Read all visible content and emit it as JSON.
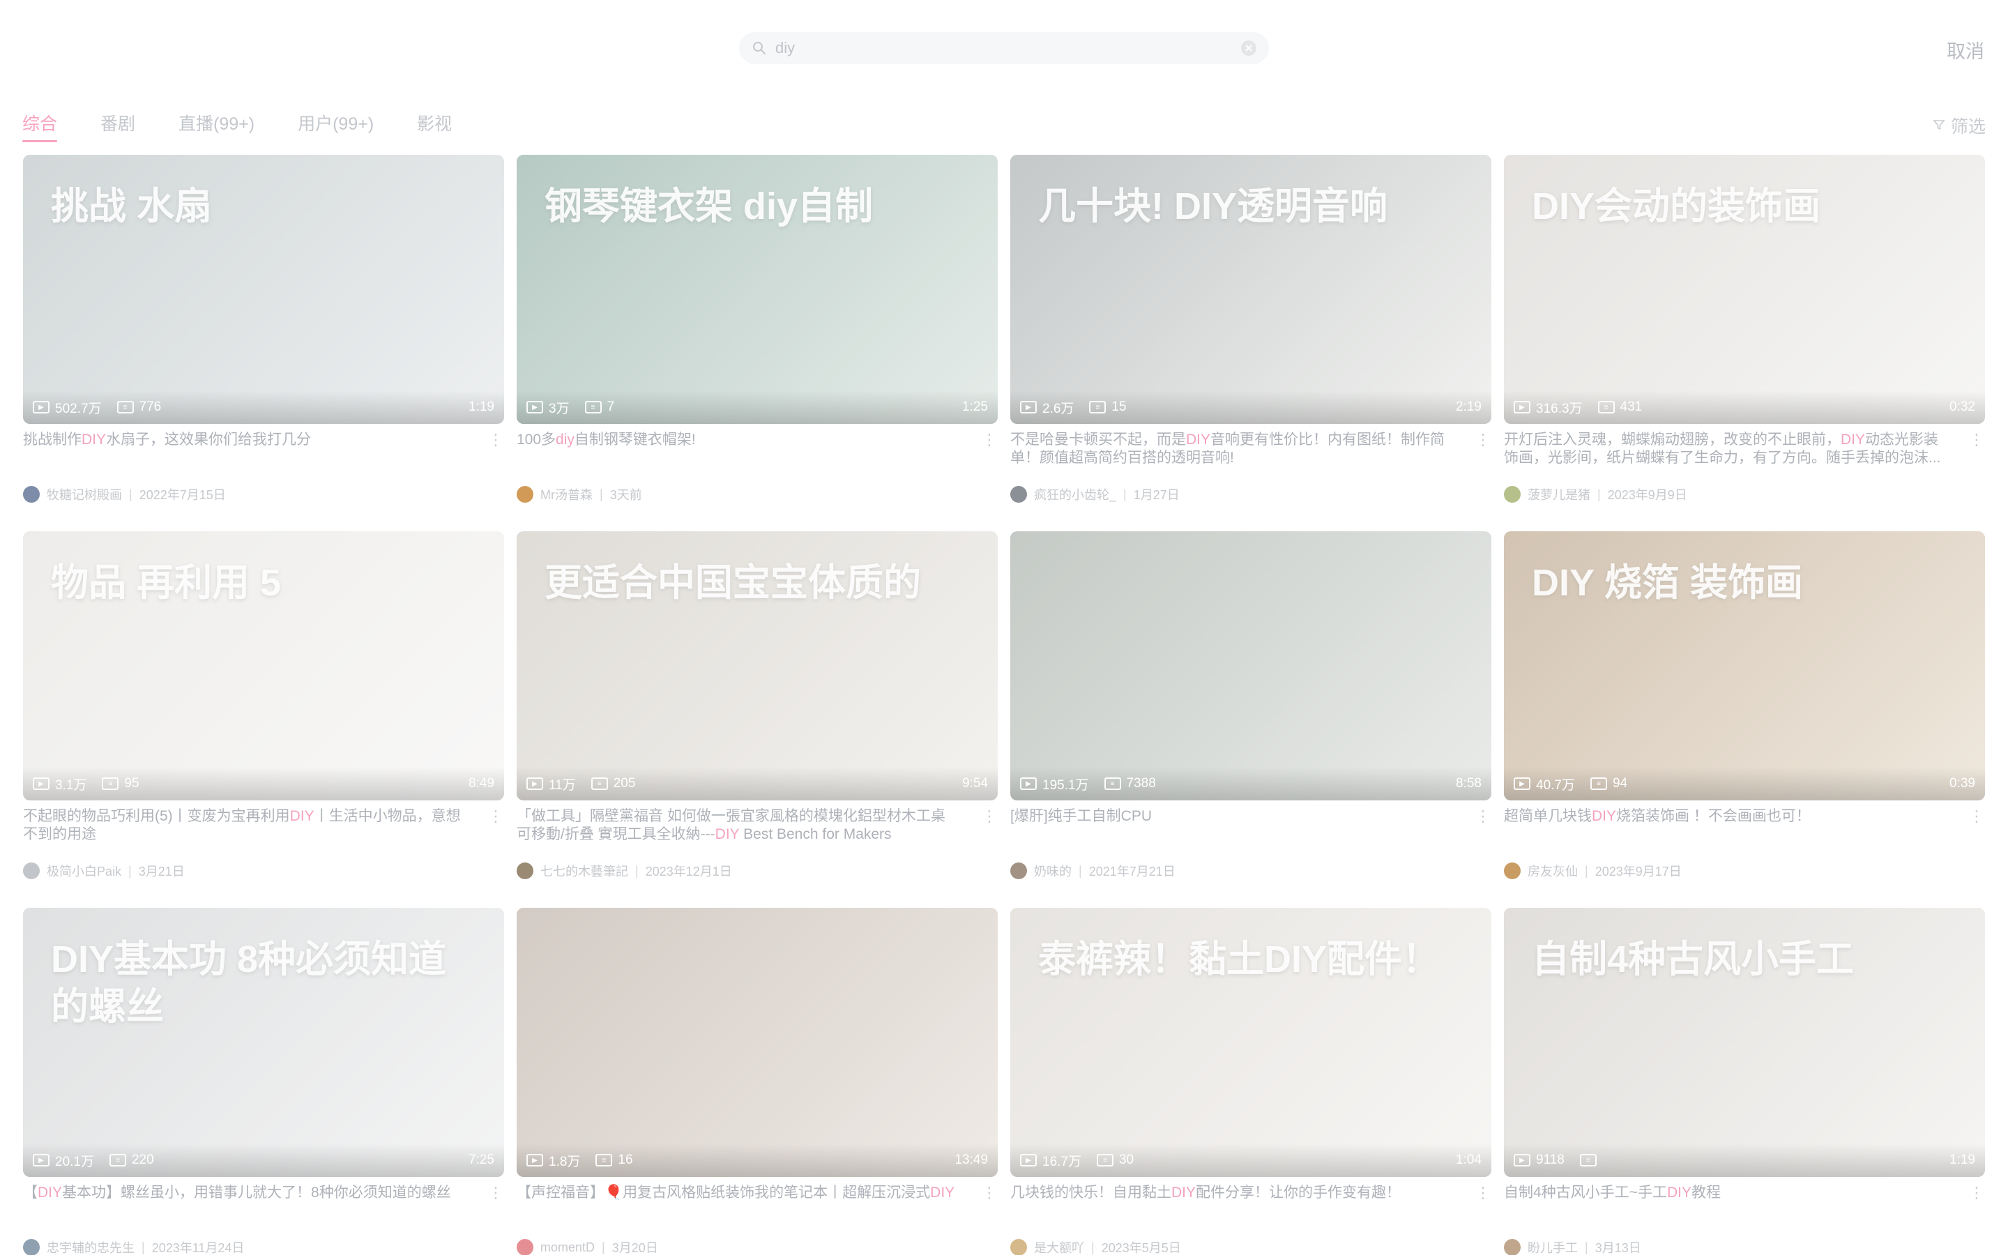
{
  "search": {
    "value": "diy",
    "cancel_label": "取消"
  },
  "tabs": [
    {
      "label": "综合",
      "active": true
    },
    {
      "label": "番剧",
      "active": false
    },
    {
      "label": "直播(99+)",
      "active": false
    },
    {
      "label": "用户(99+)",
      "active": false
    },
    {
      "label": "影视",
      "active": false
    }
  ],
  "filter_label": "筛选",
  "colors": {
    "accent": "#f6a3bf",
    "highlight": "#f4a3bd"
  },
  "videos": [
    {
      "title": "挑战制作DIY水扇子，这效果你们给我打几分",
      "views": "502.7万",
      "danmaku": "776",
      "duration": "1:19",
      "author": "牧糖记树殿画",
      "date": "2022年7月15日",
      "thumb_text": "挑战 水扇",
      "thumb_colors": [
        "#9aa7a9",
        "#d8dde0"
      ],
      "avatar_color": "#7d8ca8"
    },
    {
      "title": "100多diy自制钢琴键衣帽架!",
      "views": "3万",
      "danmaku": "7",
      "duration": "1:25",
      "author": "Mr汤普森",
      "date": "3天前",
      "thumb_text": "钢琴键衣架 diy自制",
      "thumb_colors": [
        "#5f8a7c",
        "#c7d6cf"
      ],
      "avatar_color": "#d19a56"
    },
    {
      "title": "不是哈曼卡顿买不起，而是DIY音响更有性价比！内有图纸！制作简单！颜值超高简约百搭的透明音响!",
      "views": "2.6万",
      "danmaku": "15",
      "duration": "2:19",
      "author": "疯狂的小齿轮_",
      "date": "1月27日",
      "thumb_text": "几十块! DIY透明音响",
      "thumb_colors": [
        "#7d8688",
        "#e1e2dd"
      ],
      "avatar_color": "#8b8f96"
    },
    {
      "title": "开灯后注入灵魂，蝴蝶煽动翅膀，改变的不止眼前，DIY动态光影装饰画，光影间，纸片蝴蝶有了生命力，有了方向。随手丢掉的泡沫...",
      "views": "316.3万",
      "danmaku": "431",
      "duration": "0:32",
      "author": "菠萝儿是猪",
      "date": "2023年9月9日",
      "thumb_text": "DIY会动的装饰画",
      "thumb_colors": [
        "#c6c1bb",
        "#ecebe8"
      ],
      "avatar_color": "#b5c08a"
    },
    {
      "title": "不起眼的物品巧利用(5)丨变废为宝再利用DIY丨生活中小物品，意想不到的用途",
      "views": "3.1万",
      "danmaku": "95",
      "duration": "8:49",
      "author": "极简小白Paik",
      "date": "3月21日",
      "thumb_text": "物品 再利用 5",
      "thumb_colors": [
        "#d9d6d1",
        "#f1f0ee"
      ],
      "avatar_color": "#c2c5c9"
    },
    {
      "title": "「做工具」隔壁黨福音 如何做一張宜家風格的模塊化鋁型材木工桌 可移動/折叠 實現工具全收納---DIY Best Bench for Makers",
      "views": "11万",
      "danmaku": "205",
      "duration": "9:54",
      "author": "七七的木藝筆記",
      "date": "2023年12月1日",
      "thumb_text": "更适合中国宝宝体质的",
      "thumb_colors": [
        "#b9b2a6",
        "#e5e2dc"
      ],
      "avatar_color": "#9a8a74"
    },
    {
      "title": "[爆肝]纯手工自制CPU",
      "views": "195.1万",
      "danmaku": "7388",
      "duration": "8:58",
      "author": "奶味的",
      "date": "2021年7月21日",
      "thumb_text": "",
      "thumb_colors": [
        "#7e8a80",
        "#cfd4cf"
      ],
      "avatar_color": "#a29284"
    },
    {
      "title": "超简单几块钱DIY烧箔装饰画 ！不会画画也可！",
      "views": "40.7万",
      "danmaku": "94",
      "duration": "0:39",
      "author": "房友灰仙",
      "date": "2023年9月17日",
      "thumb_text": "DIY 烧箔 装饰画",
      "thumb_colors": [
        "#9c7b55",
        "#ddcdb5"
      ],
      "avatar_color": "#c89c62"
    },
    {
      "title": "【DIY基本功】螺丝虽小，用错事儿就大了！8种你必须知道的螺丝",
      "views": "20.1万",
      "danmaku": "220",
      "duration": "7:25",
      "author": "忠宇辅的忠先生",
      "date": "2023年11月24日",
      "thumb_text": "DIY基本功 8种必须知道的螺丝",
      "thumb_colors": [
        "#b9bcbe",
        "#e6e7e8"
      ],
      "avatar_color": "#8fa0b0"
    },
    {
      "title": "【声控福音】🎈用复古风格贴纸装饰我的笔记本丨超解压沉浸式DIY",
      "views": "1.8万",
      "danmaku": "16",
      "duration": "13:49",
      "author": "momentD",
      "date": "3月20日",
      "thumb_text": "",
      "thumb_colors": [
        "#9e8c7d",
        "#dcd2c7"
      ],
      "avatar_color": "#e58f95"
    },
    {
      "title": "几块钱的快乐！自用黏土DIY配件分享！让你的手作变有趣！",
      "views": "16.7万",
      "danmaku": "30",
      "duration": "1:04",
      "author": "是大额吖",
      "date": "2023年5月5日",
      "thumb_text": "泰裤辣！黏土DIY配件！",
      "thumb_colors": [
        "#c9c3bb",
        "#eeebe7"
      ],
      "avatar_color": "#d6b98a"
    },
    {
      "title": "自制4种古风小手工~手工DIY教程",
      "views": "9118",
      "danmaku": "",
      "duration": "1:19",
      "author": "盼儿手工",
      "date": "3月13日",
      "thumb_text": "自制4种古风小手工",
      "thumb_colors": [
        "#bdb8b1",
        "#ebe8e4"
      ],
      "avatar_color": "#c0a68c"
    }
  ]
}
